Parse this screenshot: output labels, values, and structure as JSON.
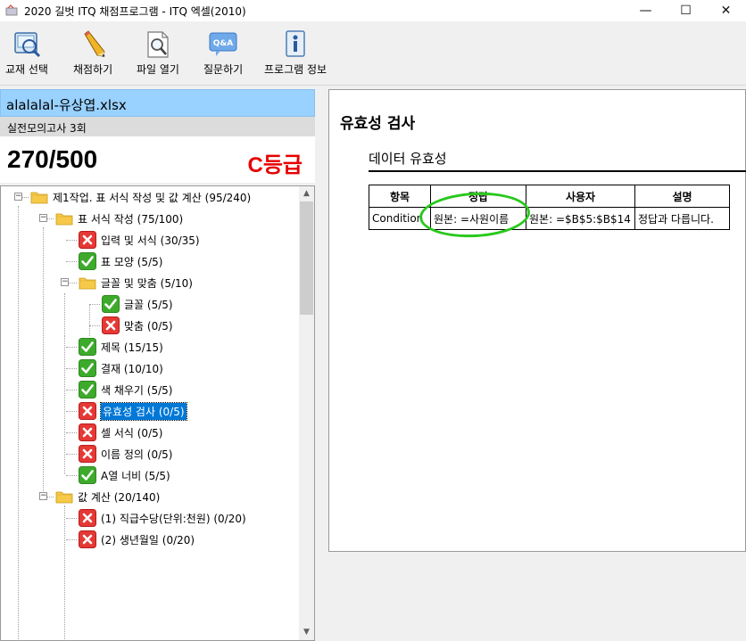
{
  "window": {
    "title": "2020 길벗 ITQ 채점프로그램 - ITQ 엑셀(2010)",
    "minimize": "—",
    "maximize": "☐",
    "close": "✕"
  },
  "toolbar": {
    "items": [
      {
        "label": "교재 선택",
        "icon": "textbook-select-icon"
      },
      {
        "label": "채점하기",
        "icon": "pencil-icon"
      },
      {
        "label": "파일 열기",
        "icon": "file-open-icon"
      },
      {
        "label": "질문하기",
        "icon": "qa-icon"
      },
      {
        "label": "프로그램 정보",
        "icon": "info-icon"
      }
    ]
  },
  "left": {
    "file_name": "alalalal-유상엽.xlsx",
    "exam_name": "실전모의고사 3회",
    "score": "270/500",
    "grade": "C등급"
  },
  "tree": [
    {
      "label": "제1작업. 표 서식 작성 및 값 계산 (95/240)",
      "type": "folder"
    },
    {
      "label": "표 서식 작성 (75/100)",
      "type": "folder"
    },
    {
      "label": "입력 및 서식 (30/35)",
      "type": "fail"
    },
    {
      "label": "표 모양 (5/5)",
      "type": "pass"
    },
    {
      "label": "글꼴 및 맞춤 (5/10)",
      "type": "folder"
    },
    {
      "label": "글꼴 (5/5)",
      "type": "pass"
    },
    {
      "label": "맞춤 (0/5)",
      "type": "fail"
    },
    {
      "label": "제목 (15/15)",
      "type": "pass"
    },
    {
      "label": "결재 (10/10)",
      "type": "pass"
    },
    {
      "label": "색 채우기 (5/5)",
      "type": "pass"
    },
    {
      "label": "유효성 검사 (0/5)",
      "type": "fail",
      "selected": true
    },
    {
      "label": "셀 서식 (0/5)",
      "type": "fail"
    },
    {
      "label": "이름 정의 (0/5)",
      "type": "fail"
    },
    {
      "label": "A열 너비 (5/5)",
      "type": "pass"
    },
    {
      "label": "값 계산 (20/140)",
      "type": "folder"
    },
    {
      "label": "(1) 직급수당(단위:천원) (0/20)",
      "type": "fail"
    },
    {
      "label": "(2) 생년월일 (0/20)",
      "type": "fail"
    }
  ],
  "right": {
    "section_title": "유효성 검사",
    "sub_title": "데이터 유효성",
    "table": {
      "headers": [
        "항목",
        "정답",
        "사용자",
        "설명"
      ],
      "rows": [
        [
          "Condition",
          "원본: =사원이름",
          "원본: =$B$5:$B$14",
          "정답과 다릅니다."
        ]
      ]
    }
  },
  "colors": {
    "selected_bg": "#0078d7",
    "file_bar_bg": "#99d1ff",
    "grade_red": "#e60000",
    "fail_red": "#e53935",
    "pass_green": "#3daa2c",
    "annotation_green": "#29c81c"
  }
}
